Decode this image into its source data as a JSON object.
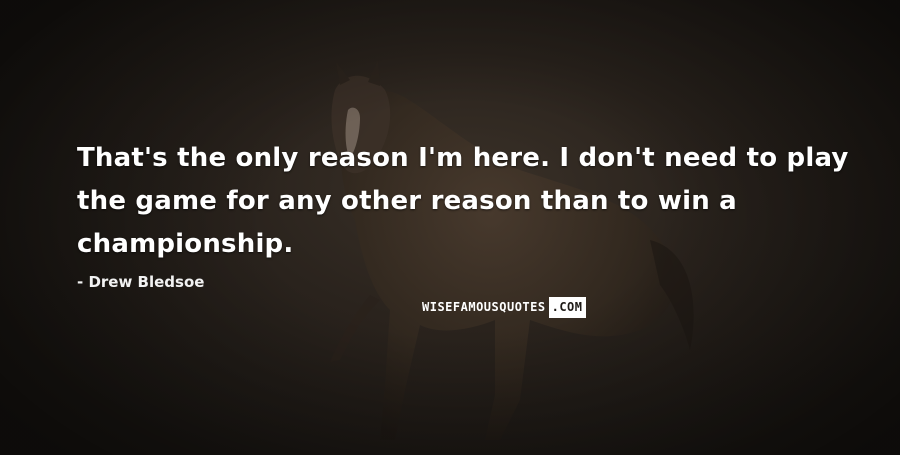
{
  "quote": {
    "text": "That's the only reason I'm here. I don't need to play the game for any other reason than to win a championship.",
    "author": "- Drew Bledsoe"
  },
  "watermark": {
    "part1": "WISEFAMOUSQUOTES",
    "part2": ".COM"
  },
  "colors": {
    "background": "#2a231d",
    "text": "#ffffff"
  },
  "background_image": "horse-photo"
}
